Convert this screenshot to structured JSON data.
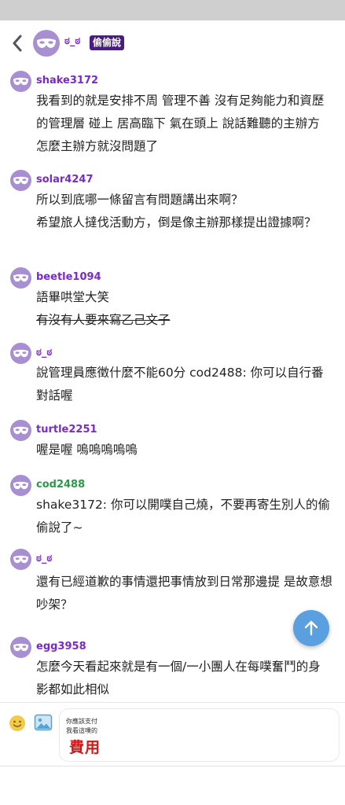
{
  "header": {
    "username": "ಠ_ಠ",
    "badge": "偷偷說"
  },
  "colors": {
    "accent_purple": "#7a2ac8",
    "badge_bg": "#4a1a85",
    "avatar_bg": "#a78fd2",
    "green_user": "#2a9a47",
    "fab": "#5aa0e0",
    "fee_red": "#d21818"
  },
  "comments": [
    {
      "user": "shake3172",
      "text": "我看到的就是安排不周 管理不善 沒有足夠能力和資歷的管理層 碰上 居高臨下 氣在頭上 說話難聽的主辦方 怎麼主辦方就沒問題了"
    },
    {
      "user": "solar4247",
      "text": "所以到底哪一條留言有問題講出來啊？\n希望旅人撻伐活動方，倒是像主辦那樣提出證據啊？"
    },
    {
      "user": "beetle1094",
      "text": "語畢哄堂大笑",
      "text2": "有沒有人要來寫乙己文子"
    },
    {
      "user": "ಠ_ಠ",
      "text": "說管理員應徵什麼不能60分 cod2488: 你可以自行番對話喔"
    },
    {
      "user": "turtle2251",
      "text": "喔是喔 嗚嗚嗚嗚嗚"
    },
    {
      "user": "cod2488",
      "text": "shake3172: 你可以開噗自己燒，不要再寄生別人的偷偷說了~"
    },
    {
      "user": "ಠ_ಠ",
      "text": "還有已經道歉的事情還把事情放到日常那邊提 是故意想吵架？"
    },
    {
      "user": "egg3958",
      "text": "怎麼今天看起來就是有一個/一小團人在每噗奮鬥的身影都如此相似"
    }
  ],
  "ad": {
    "line1": "你應該支付",
    "line2": "我看這噗的",
    "fee": "費用"
  },
  "icons": {
    "back": "chevron-left-icon",
    "avatar": "mask-icon",
    "fab": "arrow-up-icon",
    "emoji": "smiley-icon",
    "image": "image-icon"
  }
}
